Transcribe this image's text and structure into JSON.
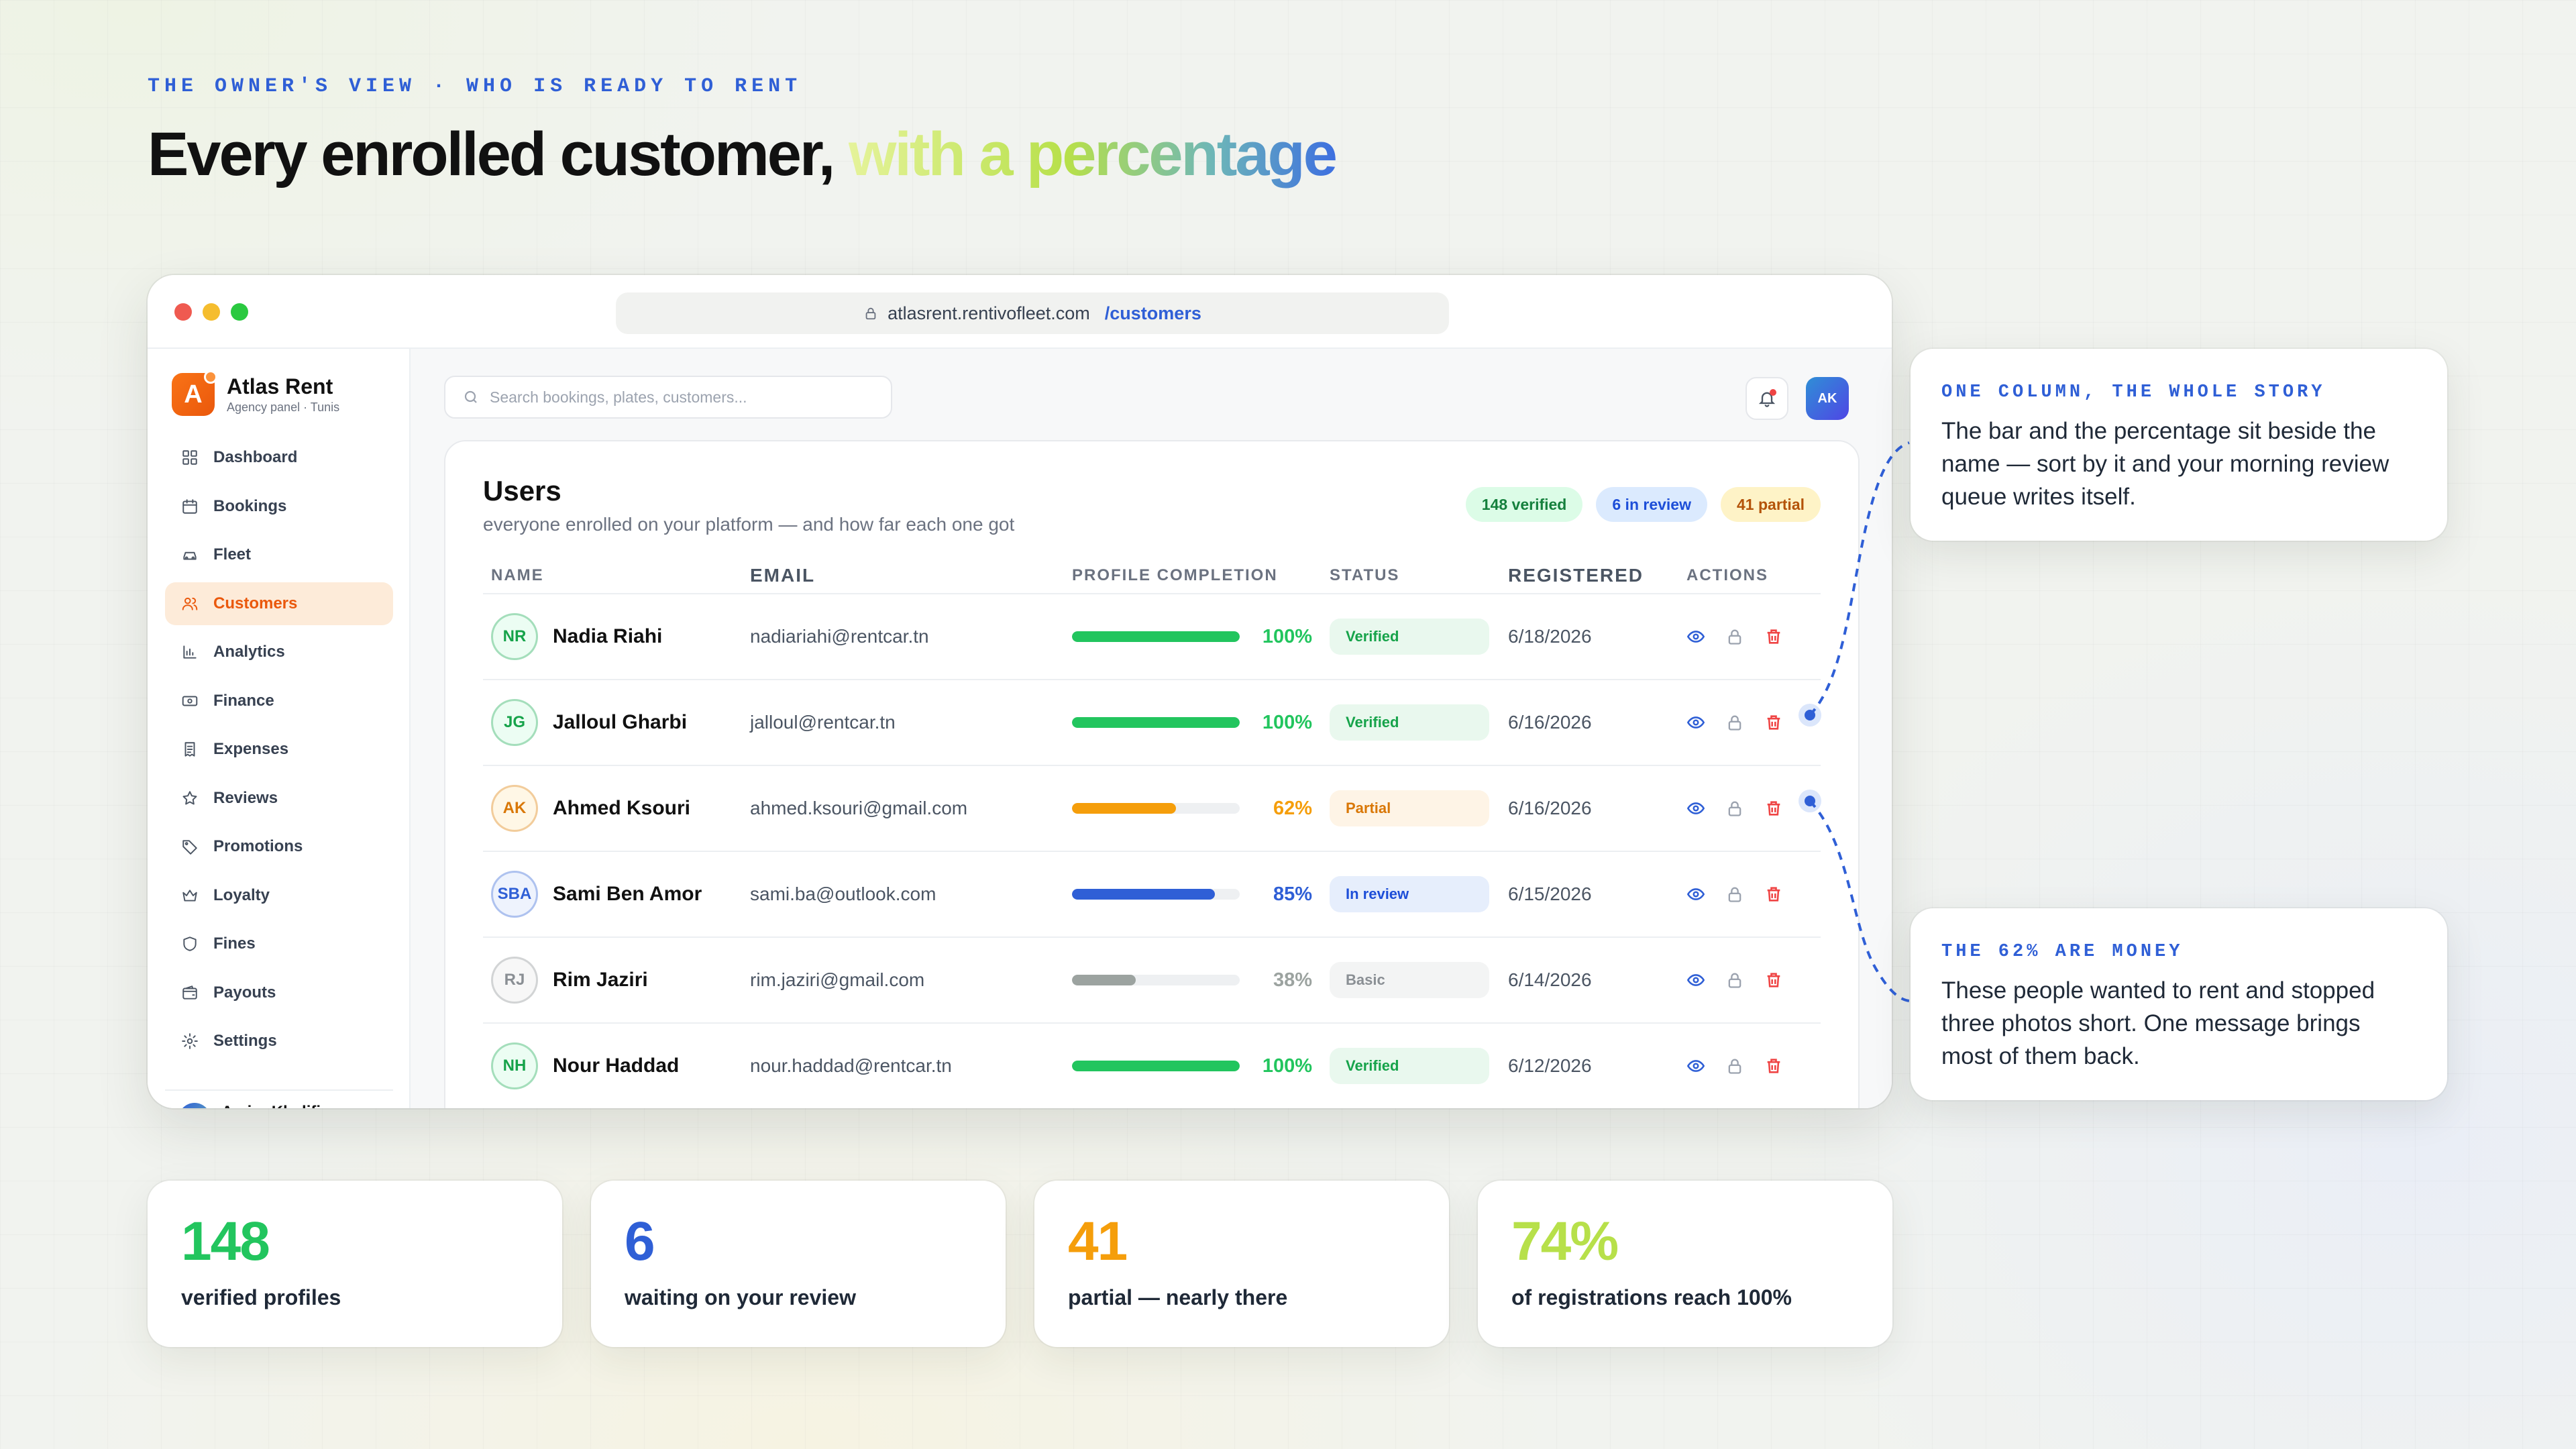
{
  "hero": {
    "eyebrow": "THE OWNER'S VIEW · WHO IS READY TO RENT",
    "headline_main": "Every enrolled customer, ",
    "headline_accent": "with a percentage"
  },
  "browser": {
    "url_host": "atlasrent.rentivofleet.com",
    "url_path": "/customers"
  },
  "sidebar": {
    "brand_letter": "A",
    "brand_name": "Atlas Rent",
    "brand_sub": "Agency panel · Tunis",
    "items": [
      {
        "label": "Dashboard",
        "icon": "grid-icon",
        "active": false
      },
      {
        "label": "Bookings",
        "icon": "calendar-icon",
        "active": false
      },
      {
        "label": "Fleet",
        "icon": "car-icon",
        "active": false
      },
      {
        "label": "Customers",
        "icon": "users-icon",
        "active": true
      },
      {
        "label": "Analytics",
        "icon": "bar-chart-icon",
        "active": false
      },
      {
        "label": "Finance",
        "icon": "banknote-icon",
        "active": false
      },
      {
        "label": "Expenses",
        "icon": "receipt-icon",
        "active": false
      },
      {
        "label": "Reviews",
        "icon": "star-icon",
        "active": false
      },
      {
        "label": "Promotions",
        "icon": "tag-icon",
        "active": false
      },
      {
        "label": "Loyalty",
        "icon": "crown-icon",
        "active": false
      },
      {
        "label": "Fines",
        "icon": "shield-icon",
        "active": false
      },
      {
        "label": "Payouts",
        "icon": "wallet-icon",
        "active": false
      },
      {
        "label": "Settings",
        "icon": "gear-icon",
        "active": false
      }
    ],
    "user_name": "Amira Khelifi"
  },
  "topbar": {
    "search_placeholder": "Search bookings, plates, customers...",
    "avatar_initials": "AK"
  },
  "users_card": {
    "title": "Users",
    "subtitle": "everyone enrolled on your platform — and how far each one got",
    "pills": {
      "verified": "148 verified",
      "review": "6 in review",
      "partial": "41 partial"
    },
    "columns": [
      "NAME",
      "EMAIL",
      "PROFILE COMPLETION",
      "STATUS",
      "REGISTERED",
      "ACTIONS"
    ],
    "rows": [
      {
        "initials": "NR",
        "name": "Nadia Riahi",
        "email": "nadiariahi@rentcar.tn",
        "completion": 100,
        "pct_label": "100%",
        "status": "Verified",
        "registered": "6/18/2026",
        "color": "#22c55e",
        "status_bg": "#e9f8ee",
        "status_fg": "#16a34a",
        "avatar_bg": "#ecfdf3",
        "avatar_fg": "#16a34a"
      },
      {
        "initials": "JG",
        "name": "Jalloul Gharbi",
        "email": "jalloul@rentcar.tn",
        "completion": 100,
        "pct_label": "100%",
        "status": "Verified",
        "registered": "6/16/2026",
        "color": "#22c55e",
        "status_bg": "#e9f8ee",
        "status_fg": "#16a34a",
        "avatar_bg": "#ecfdf3",
        "avatar_fg": "#16a34a"
      },
      {
        "initials": "AK",
        "name": "Ahmed Ksouri",
        "email": "ahmed.ksouri@gmail.com",
        "completion": 62,
        "pct_label": "62%",
        "status": "Partial",
        "registered": "6/16/2026",
        "color": "#f59e0b",
        "status_bg": "#fef4e6",
        "status_fg": "#d97706",
        "avatar_bg": "#fff7e6",
        "avatar_fg": "#d97706"
      },
      {
        "initials": "SBA",
        "name": "Sami Ben Amor",
        "email": "sami.ba@outlook.com",
        "completion": 85,
        "pct_label": "85%",
        "status": "In review",
        "registered": "6/15/2026",
        "color": "#2f5fd6",
        "status_bg": "#e6eefc",
        "status_fg": "#1d4ed8",
        "avatar_bg": "#eef3fd",
        "avatar_fg": "#2f5fd6"
      },
      {
        "initials": "RJ",
        "name": "Rim Jaziri",
        "email": "rim.jaziri@gmail.com",
        "completion": 38,
        "pct_label": "38%",
        "status": "Basic",
        "registered": "6/14/2026",
        "color": "#9ca3a0",
        "status_bg": "#f3f4f4",
        "status_fg": "#8a8f94",
        "avatar_bg": "#f7f7f7",
        "avatar_fg": "#8a8f94"
      },
      {
        "initials": "NH",
        "name": "Nour Haddad",
        "email": "nour.haddad@rentcar.tn",
        "completion": 100,
        "pct_label": "100%",
        "status": "Verified",
        "registered": "6/12/2026",
        "color": "#22c55e",
        "status_bg": "#e9f8ee",
        "status_fg": "#16a34a",
        "avatar_bg": "#ecfdf3",
        "avatar_fg": "#16a34a"
      }
    ]
  },
  "callouts": [
    {
      "title": "ONE COLUMN, THE WHOLE STORY",
      "body": "The bar and the percentage sit beside the name — sort by it and your morning review queue writes itself."
    },
    {
      "title": "THE 62% ARE MONEY",
      "body": "These people wanted to rent and stopped three photos short. One message brings most of them back."
    }
  ],
  "stats": [
    {
      "value": "148",
      "label": "verified profiles",
      "color": "#22c55e"
    },
    {
      "value": "6",
      "label": "waiting on your review",
      "color": "#2f5fd6"
    },
    {
      "value": "41",
      "label": "partial — nearly there",
      "color": "#f59e0b"
    },
    {
      "value": "74%",
      "label": "of registrations reach 100%",
      "color": "#b7e04a"
    }
  ]
}
